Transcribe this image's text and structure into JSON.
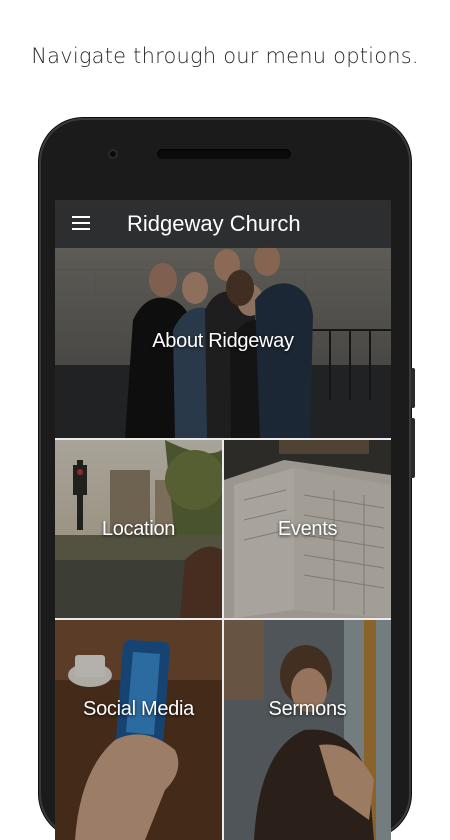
{
  "promo": {
    "caption": "Navigate through our menu options."
  },
  "app": {
    "title": "Ridgeway Church",
    "menu_icon": "hamburger-menu-icon"
  },
  "tiles": [
    {
      "label": "About Ridgeway",
      "image": "group-of-friends-photo"
    },
    {
      "label": "Location",
      "image": "city-street-photo"
    },
    {
      "label": "Events",
      "image": "open-planner-photo"
    },
    {
      "label": "Social Media",
      "image": "hand-holding-phone-photo"
    },
    {
      "label": "Sermons",
      "image": "woman-reading-photo"
    }
  ],
  "colors": {
    "appbar": "#2a2c2e",
    "phone_frame": "#1b1b1b",
    "text_light": "#ffffff",
    "caption": "#2b2b2b"
  }
}
